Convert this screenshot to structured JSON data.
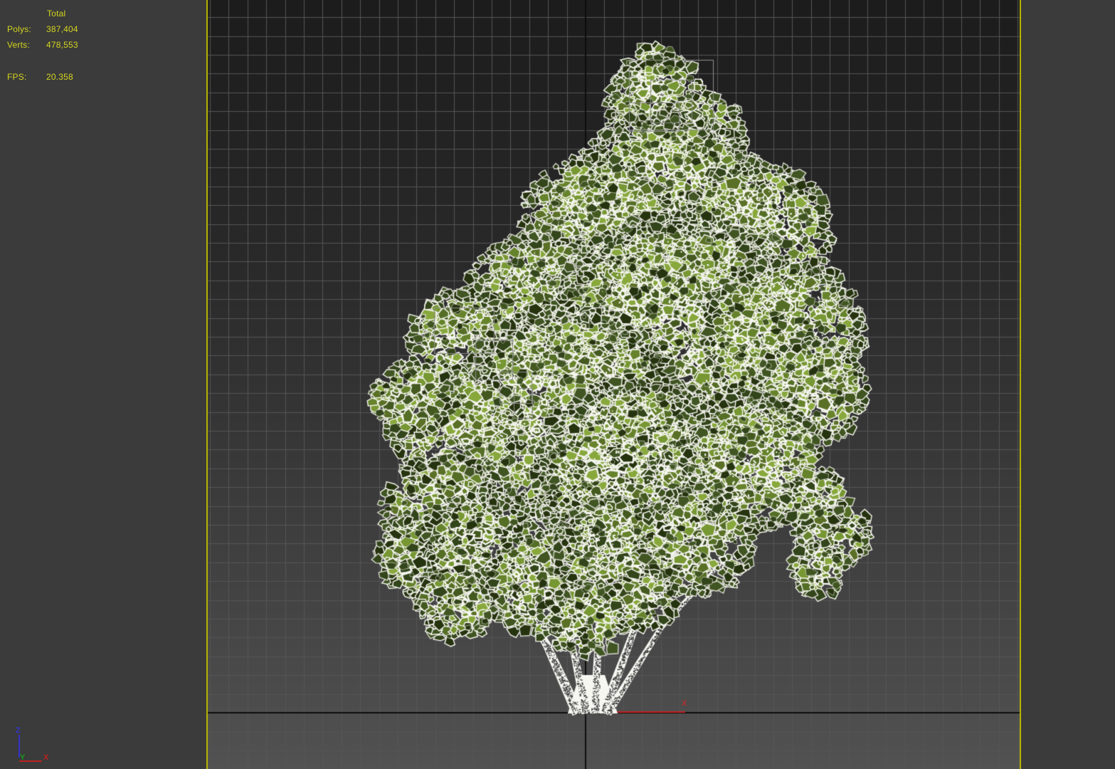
{
  "stats": {
    "total": "Total",
    "polys_label": "Polys:",
    "polys_value": "387,404",
    "verts_label": "Verts:",
    "verts_value": "478,553",
    "fps_label": "FPS:",
    "fps_value": "20.358"
  },
  "gizmo": {
    "x": "X",
    "y": "Y",
    "z": "Z"
  },
  "origin_axis": {
    "label": "X"
  },
  "colors": {
    "panel_bg": "#3b3b3b",
    "stats_text": "#d4d41f",
    "gizmo_x": "#bb2222",
    "gizmo_y": "#18991a",
    "gizmo_z": "#3434cc",
    "origin_label_red": "#b03030"
  },
  "render": {
    "bg_top": "#1c1c1c",
    "bg_mid": "#2a2a2a",
    "bg_low": "#404040",
    "bg_bottom": "#525252",
    "grid": "#555555",
    "axis_black": "#0d0d0d",
    "x_axis_red": "#c42222",
    "border_yellow": "#b9b900",
    "wire_white": "#f7f7f2",
    "wire_dim": "#d8d8d0",
    "leaf_mid": [
      "#44591f",
      "#556e26",
      "#66832c",
      "#779733",
      "#88a83c",
      "#5a7026"
    ],
    "leaf_dark": [
      "#26330f",
      "#33451a",
      "#405522"
    ],
    "trunk_speckle": "#2e2e2e",
    "helper_box": "#8f8f8f"
  }
}
